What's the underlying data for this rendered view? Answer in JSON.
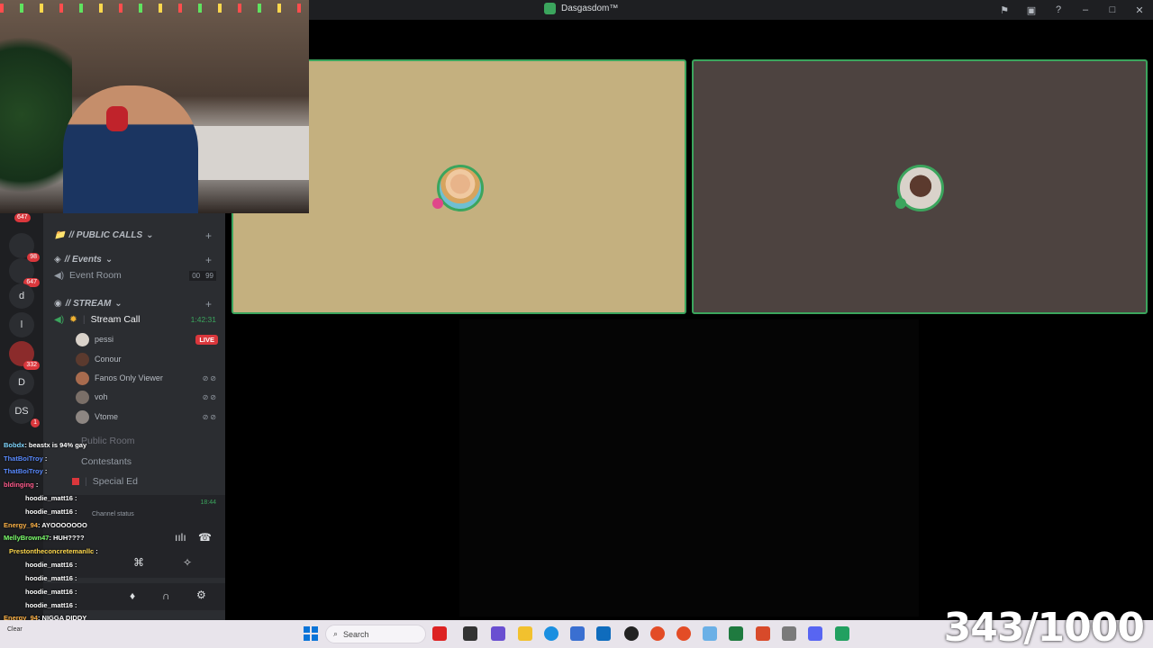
{
  "window": {
    "title": "Dasgasdom™"
  },
  "titlebar_icons": [
    "inbox-icon",
    "screen-icon",
    "help-icon",
    "minimize-icon",
    "maximize-icon",
    "close-icon"
  ],
  "rail": {
    "top_badge": "647",
    "items": [
      {
        "label": "",
        "badge": "98"
      },
      {
        "label": "",
        "badge": "647"
      },
      {
        "label": "d",
        "badge": ""
      },
      {
        "label": "l",
        "badge": ""
      },
      {
        "label": "",
        "badge": "332"
      },
      {
        "label": "D",
        "badge": ""
      },
      {
        "label": "DS",
        "badge": "1"
      }
    ]
  },
  "channels": {
    "categories": {
      "public_calls": "// PUBLIC CALLS",
      "events": "// Events",
      "stream": "// STREAM"
    },
    "event_room": {
      "name": "Event Room",
      "count_a": "00",
      "count_b": "99"
    },
    "stream_call": {
      "name": "Stream Call",
      "timer": "1:42:31"
    },
    "members": [
      {
        "name": "pessi",
        "status": "LIVE"
      },
      {
        "name": "Conour",
        "status": ""
      },
      {
        "name": "Fanos Only Viewer",
        "status": "muted"
      },
      {
        "name": "voh",
        "status": "muted"
      },
      {
        "name": "Vtome",
        "status": "muted"
      }
    ],
    "public_room": "Public Room",
    "contestants": "Contestants",
    "special_ed": "Special Ed",
    "special_ed_time": "18:44",
    "channel_status": "Channel status"
  },
  "chat": [
    {
      "user": "Bobdx",
      "color": "#7fd6ff",
      "msg": ": beastx is 94% gay"
    },
    {
      "user": "ThatBoiTroy",
      "color": "#5a8bff",
      "msg": " :"
    },
    {
      "user": "ThatBoiTroy",
      "color": "#5a8bff",
      "msg": " :"
    },
    {
      "user": "bldinging",
      "color": "#ff5a8b",
      "msg": " :"
    },
    {
      "user": "hoodie_matt16",
      "color": "#ffffff",
      "msg": " :"
    },
    {
      "user": "hoodie_matt16",
      "color": "#ffffff",
      "msg": " :"
    },
    {
      "user": "Energy_94",
      "color": "#ffb347",
      "msg": ": AYOOOOOOO"
    },
    {
      "user": "MellyBrown47",
      "color": "#7cff6b",
      "msg": ": HUH????"
    },
    {
      "user": "Prestontheconcretemanllc",
      "color": "#ffd84d",
      "msg": " :"
    },
    {
      "user": "hoodie_matt16",
      "color": "#ffffff",
      "msg": " :"
    },
    {
      "user": "hoodie_matt16",
      "color": "#ffffff",
      "msg": " :"
    },
    {
      "user": "hoodie_matt16",
      "color": "#ffffff",
      "msg": " :"
    },
    {
      "user": "hoodie_matt16",
      "color": "#ffffff",
      "msg": " :"
    },
    {
      "user": "Energy_94",
      "color": "#ffb347",
      "msg": ": NIGGA DIDDY"
    }
  ],
  "counter": "343/1000",
  "taskbar": {
    "search_placeholder": "Search",
    "left_text": "Clear",
    "apps": [
      "app-1",
      "app-2",
      "app-3",
      "app-4",
      "app-5",
      "app-6",
      "app-7",
      "app-8",
      "app-9",
      "app-10",
      "app-11",
      "app-12",
      "app-13",
      "app-14",
      "app-15",
      "app-16",
      "app-17",
      "app-18",
      "app-19",
      "app-20"
    ]
  }
}
